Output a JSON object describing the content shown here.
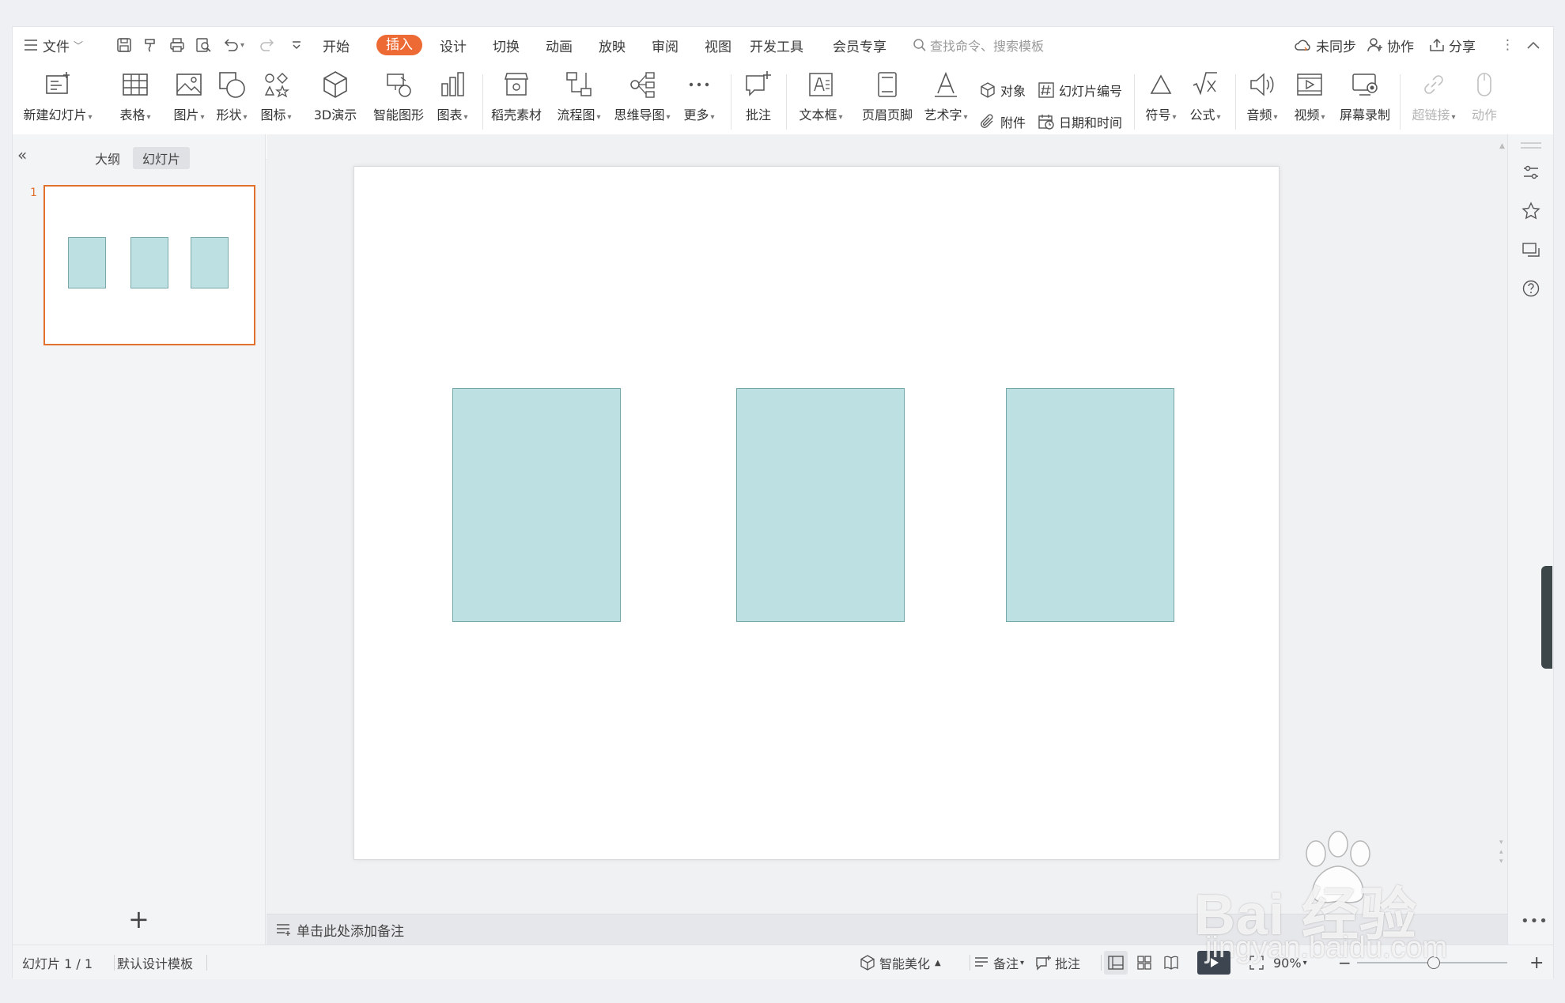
{
  "menubar": {
    "file_label": "文件",
    "tabs": [
      "开始",
      "插入",
      "设计",
      "切换",
      "动画",
      "放映",
      "审阅",
      "视图",
      "开发工具",
      "会员专享"
    ],
    "active_tab": "插入",
    "search_placeholder": "查找命令、搜索模板",
    "sync_label": "未同步",
    "collab_label": "协作",
    "share_label": "分享"
  },
  "ribbon": {
    "new_slide": "新建幻灯片",
    "table": "表格",
    "picture": "图片",
    "shape": "形状",
    "icon": "图标",
    "demo3d": "3D演示",
    "smartart": "智能图形",
    "chart": "图表",
    "material": "稻壳素材",
    "flowchart": "流程图",
    "mindmap": "思维导图",
    "more": "更多",
    "comment": "批注",
    "textbox": "文本框",
    "header_footer": "页眉页脚",
    "wordart": "艺术字",
    "object": "对象",
    "slide_number": "幻灯片编号",
    "attachment": "附件",
    "datetime": "日期和时间",
    "symbol": "符号",
    "formula": "公式",
    "audio": "音频",
    "video": "视频",
    "screen_record": "屏幕录制",
    "hyperlink": "超链接",
    "action": "动作"
  },
  "leftpanel": {
    "tab_outline": "大纲",
    "tab_slides": "幻灯片",
    "slide_index": "1",
    "add_label": "+"
  },
  "notes": {
    "placeholder": "单击此处添加备注"
  },
  "statusbar": {
    "slide_counter": "幻灯片 1 / 1",
    "template": "默认设计模板",
    "beautify": "智能美化",
    "notes": "备注",
    "comment": "批注",
    "zoom": "90%"
  },
  "watermark": {
    "brand": "Bai  经验",
    "url": "jingyan.baidu.com"
  },
  "colors": {
    "accent": "#ed6a35",
    "shape_fill": "#bde0e2",
    "shape_border": "#75a6aa",
    "thumb_border": "#e2712e"
  }
}
